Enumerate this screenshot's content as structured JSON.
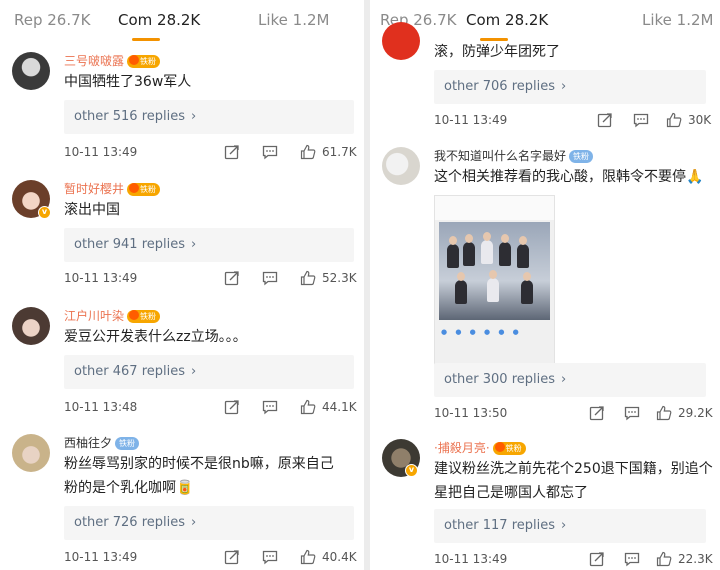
{
  "left": {
    "tabs": {
      "rep": "Rep 26.7K",
      "com": "Com 28.2K",
      "like": "Like 1.2M"
    },
    "comments": [
      {
        "username": "三号啵啵露",
        "badge": "铁粉",
        "text_lines": [
          "中国牺牲了36w军人"
        ],
        "replies": "other 516 replies",
        "date": "10-11 13:49",
        "likes": "61.7K"
      },
      {
        "username": "暂时好樱井",
        "badge": "铁粉",
        "text_lines": [
          "滚出中国"
        ],
        "replies": "other 941 replies",
        "date": "10-11 13:49",
        "likes": "52.3K"
      },
      {
        "username": "江户川叶染",
        "badge": "铁粉",
        "text_lines": [
          "爱豆公开发表什么zz立场。。。"
        ],
        "replies": "other 467 replies",
        "date": "10-11 13:48",
        "likes": "44.1K"
      },
      {
        "username": "西柚往夕",
        "badge": "铁粉",
        "text_lines": [
          "粉丝辱骂别家的时候不是很nb嘛，原来自己",
          "粉的是个乳化咖啊🥫"
        ],
        "replies": "other 726 replies",
        "date": "10-11 13:49",
        "likes": "40.4K"
      }
    ]
  },
  "right": {
    "tabs": {
      "rep": "Rep 26.7K",
      "com": "Com 28.2K",
      "like": "Like 1.2M"
    },
    "partial": {
      "text": "滚，防弹少年团死了",
      "replies": "other 706 replies",
      "date": "10-11 13:49",
      "likes": "30K"
    },
    "comments": [
      {
        "username": "我不知道叫什么名字最好",
        "badge": "铁粉",
        "text_lines": [
          "这个相关推荐看的我心酸，限韩令不要停🙏"
        ],
        "replies": "other 300 replies",
        "date": "10-11 13:50",
        "likes": "29.2K"
      },
      {
        "username": "·捕殺月亮·",
        "badge": "铁粉",
        "text_lines": [
          "建议粉丝洗之前先花个250退下国籍，别追个",
          "星把自己是哪国人都忘了"
        ],
        "replies": "other 117 replies",
        "date": "10-11 13:49",
        "likes": "22.3K"
      }
    ]
  },
  "colors": {
    "accent": "#f39200",
    "reply_link": "#5f6f82",
    "badge": "#f7a600",
    "username_highlight": "#eb7350"
  }
}
